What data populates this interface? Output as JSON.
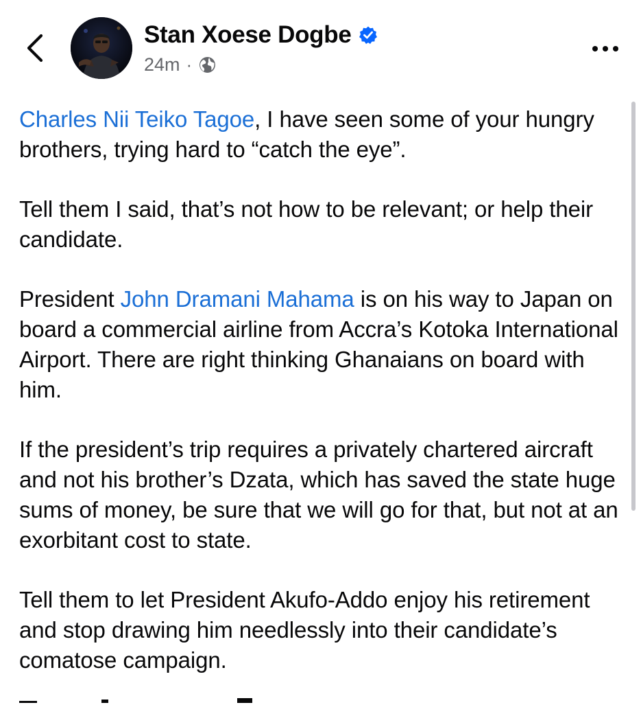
{
  "header": {
    "author_name": "Stan Xoese Dogbe",
    "timestamp": "24m",
    "separator": "·",
    "privacy_icon": "globe-icon",
    "verified_icon": "verified-badge-icon",
    "back_icon": "chevron-left-icon",
    "more_icon": "more-dots-icon"
  },
  "post": {
    "p1_mention": "Charles Nii Teiko Tagoe",
    "p1_text": ", I have seen some of your hungry brothers, trying hard to “catch the eye”.",
    "p2_text": "Tell them I said, that’s not how to be relevant; or help their candidate.",
    "p3_prefix": "President ",
    "p3_mention": "John Dramani Mahama",
    "p3_text": " is on his way to Japan on board a commercial airline from Accra’s Kotoka International Airport. There are right thinking Ghanaians on board with him.",
    "p4_text": "If the president’s trip requires a privately chartered aircraft and not his brother’s Dzata, which has saved the state huge sums of money, be sure that we will go for that, but not at an exorbitant cost to state.",
    "p5_text": "Tell them to let President Akufo-Addo enjoy his retirement and stop drawing him needlessly into their candidate’s comatose campaign."
  },
  "colors": {
    "mention": "#1b6fd6",
    "verified": "#0866ff",
    "secondary_text": "#65676b"
  }
}
